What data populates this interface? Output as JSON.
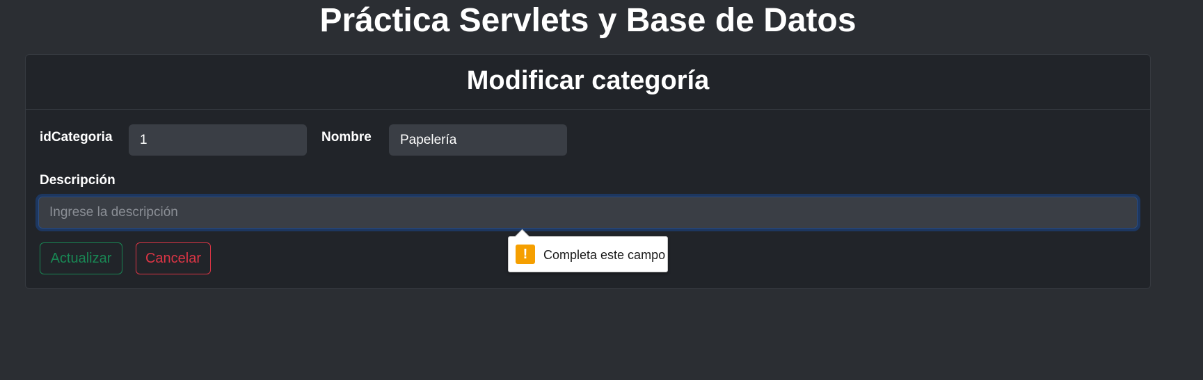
{
  "page": {
    "title": "Práctica Servlets y Base de Datos"
  },
  "card": {
    "title": "Modificar categoría"
  },
  "form": {
    "id_label": "idCategoria",
    "id_value": "1",
    "name_label": "Nombre",
    "name_value": "Papelería",
    "description_label": "Descripción",
    "description_placeholder": "Ingrese la descripción",
    "update_label": "Actualizar",
    "cancel_label": "Cancelar"
  },
  "validation": {
    "message": "Completa este campo",
    "icon": "warning-icon"
  },
  "colors": {
    "background": "#2b2e33",
    "card": "#212429",
    "input": "#3a3e45",
    "success": "#198754",
    "danger": "#dc3545",
    "warning": "#f59f00"
  }
}
